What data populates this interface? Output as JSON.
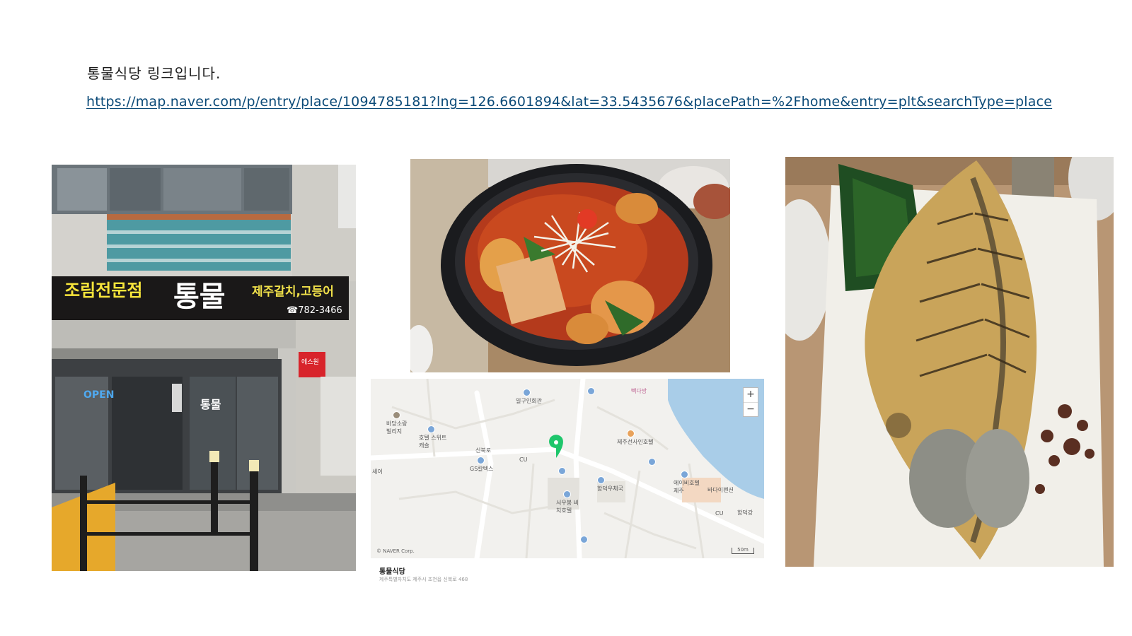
{
  "intro_text": "통물식당 링크입니다.",
  "link_url": "https://map.naver.com/p/entry/place/1094785181?lng=126.6601894&lat=33.5435676&placePath=%2Fhome&entry=plt&searchType=place",
  "storefront": {
    "sign_left": "조림전문점",
    "sign_main": "통물",
    "sign_right": "제주갈치,고등어",
    "sign_phone": "☎782-3466",
    "door_text": "통물",
    "open_sign": "OPEN",
    "security_sign": "에스원"
  },
  "map": {
    "zoom_in": "+",
    "zoom_out": "−",
    "copyright": "© NAVER Corp.",
    "scale": "50m",
    "place_name": "통물식당",
    "place_address": "제주특별자치도 제주시 조천읍 신북로 468",
    "labels": [
      {
        "text": "일구인회관",
        "cls": ""
      },
      {
        "text": "빽다방",
        "cls": "pink"
      },
      {
        "text": "바당소랑 빌리지",
        "cls": ""
      },
      {
        "text": "호텔 스위트캐슬",
        "cls": ""
      },
      {
        "text": "제주선사인호텔",
        "cls": ""
      },
      {
        "text": "신북로",
        "cls": ""
      },
      {
        "text": "CU",
        "cls": ""
      },
      {
        "text": "GS칼텍스",
        "cls": ""
      },
      {
        "text": "함덕우체국",
        "cls": ""
      },
      {
        "text": "에이비호텔 제주",
        "cls": ""
      },
      {
        "text": "바다이펜션",
        "cls": ""
      },
      {
        "text": "서우봉 비치호텔",
        "cls": ""
      },
      {
        "text": "CU",
        "cls": ""
      },
      {
        "text": "함덕강",
        "cls": ""
      },
      {
        "text": "세이",
        "cls": ""
      }
    ]
  }
}
